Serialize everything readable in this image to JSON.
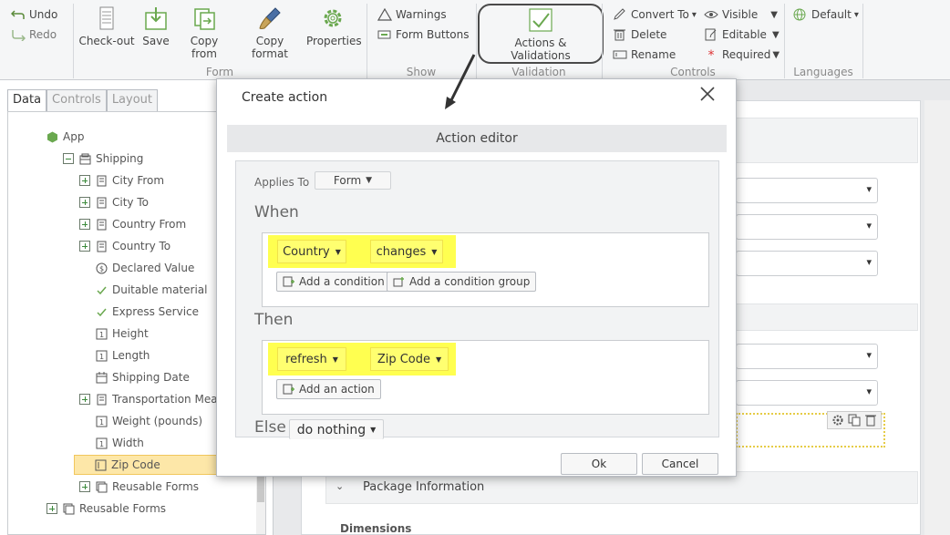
{
  "ribbon": {
    "undo": "Undo",
    "redo": "Redo",
    "form_group": {
      "label": "Form",
      "buttons": [
        "Check-out",
        "Save",
        "Copy from",
        "Copy format",
        "Properties"
      ]
    },
    "show_group": {
      "label": "Show",
      "warnings": "Warnings",
      "form_buttons": "Form Buttons"
    },
    "validation_group": {
      "label": "Validation",
      "actions_validations": "Actions & Validations"
    },
    "controls_group": {
      "label": "Controls",
      "convert_to": "Convert To",
      "delete": "Delete",
      "rename": "Rename",
      "visible": "Visible",
      "editable": "Editable",
      "required": "Required"
    },
    "languages_group": {
      "label": "Languages",
      "default": "Default"
    }
  },
  "left_panel": {
    "tabs": [
      "Data",
      "Controls",
      "Layout"
    ],
    "active_tab": "Data",
    "tree": {
      "app": "App",
      "shipping": "Shipping",
      "items": [
        "City From",
        "City To",
        "Country From",
        "Country To",
        "Declared Value",
        "Duitable material",
        "Express Service",
        "Height",
        "Length",
        "Shipping Date",
        "Transportation Mean",
        "Weight (pounds)",
        "Width",
        "Zip Code",
        "Reusable Forms"
      ],
      "root_reusable": "Reusable Forms"
    }
  },
  "background_form": {
    "package_information": "Package Information",
    "dimensions": "Dimensions"
  },
  "dialog": {
    "title": "Create action",
    "editor_title": "Action editor",
    "applies_to_label": "Applies To",
    "applies_to_value": "Form",
    "when_label": "When",
    "when_field": "Country",
    "when_operator": "changes",
    "add_condition": "Add a condition",
    "add_condition_group": "Add a condition group",
    "then_label": "Then",
    "then_action": "refresh",
    "then_target": "Zip Code",
    "add_action": "Add an action",
    "else_label": "Else",
    "else_value": "do nothing",
    "ok": "Ok",
    "cancel": "Cancel"
  },
  "colors": {
    "highlight": "#ffff50",
    "selected_row": "#fde7a8",
    "accent_green": "#6aa84f"
  }
}
